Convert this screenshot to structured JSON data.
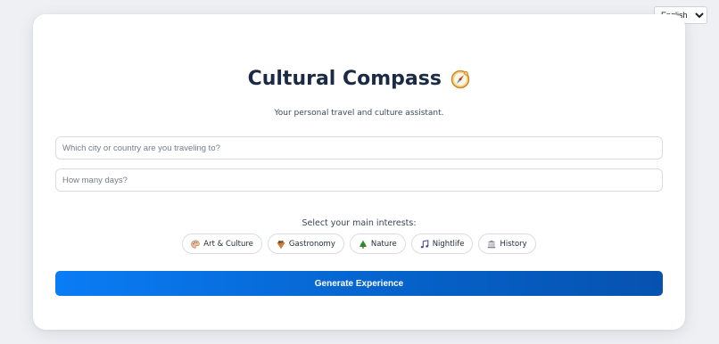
{
  "language": {
    "selected": "English",
    "options": [
      "English"
    ]
  },
  "header": {
    "title": "Cultural Compass",
    "title_icon": "compass-icon",
    "subtitle": "Your personal travel and culture assistant."
  },
  "form": {
    "destination_placeholder": "Which city or country are you traveling to?",
    "destination_value": "",
    "days_placeholder": "How many days?",
    "days_value": ""
  },
  "interests": {
    "label": "Select your main interests:",
    "items": [
      {
        "label": "Art & Culture",
        "icon": "palette-icon"
      },
      {
        "label": "Gastronomy",
        "icon": "food-icon"
      },
      {
        "label": "Nature",
        "icon": "tree-icon"
      },
      {
        "label": "Nightlife",
        "icon": "music-note-icon"
      },
      {
        "label": "History",
        "icon": "museum-icon"
      }
    ]
  },
  "actions": {
    "generate_label": "Generate Experience"
  },
  "colors": {
    "accent": "#0a6ee6",
    "title": "#1b2a45",
    "background": "#eef0f4"
  }
}
